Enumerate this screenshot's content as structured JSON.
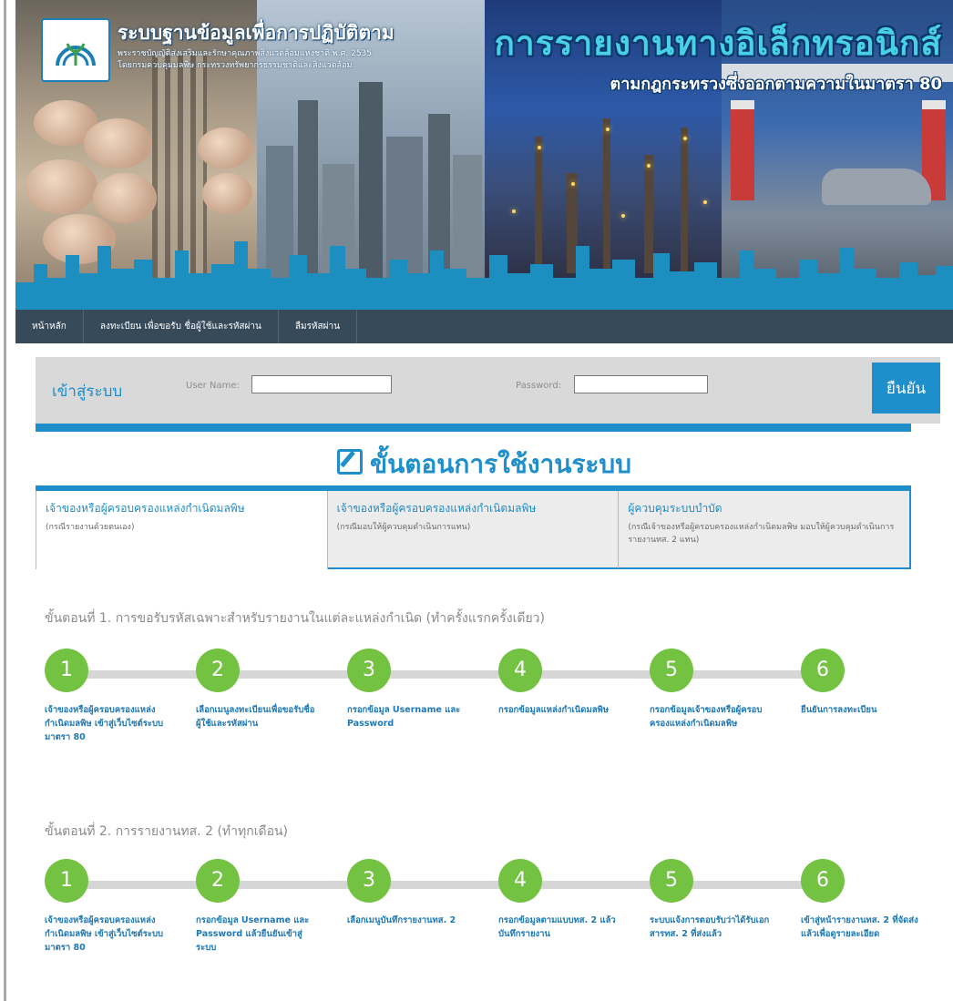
{
  "header": {
    "logo_title": "ระบบฐานข้อมูลเพื่อการปฏิบัติตาม",
    "logo_subtitle_1": "พระราชบัญญัติส่งเสริมและรักษาคุณภาพสิ่งแวดล้อมแห่งชาติ พ.ศ. 2535",
    "logo_subtitle_2": "โดยกรมควบคุมมลพิษ กระทรวงทรัพยากรธรรมชาติและสิ่งแวดล้อม",
    "hero_title": "การรายงานทางอิเล็กทรอนิกส์",
    "hero_subtitle": "ตามกฎกระทรวงซึ่งออกตามความในมาตรา 80"
  },
  "nav": {
    "items": [
      "หน้าหลัก",
      "ลงทะเบียน เพื่อขอรับ ชื่อผู้ใช้และรหัสผ่าน",
      "ลืมรหัสผ่าน"
    ]
  },
  "login": {
    "label": "เข้าสู่ระบบ",
    "username_label": "User Name:",
    "username_value": "",
    "password_label": "Password:",
    "password_value": "",
    "confirm_label": "ยืนยัน"
  },
  "steps_title": "ขั้นตอนการใช้งานระบบ",
  "tabs": [
    {
      "title": "เจ้าของหรือผู้ครอบครองแหล่งกำเนิดมลพิษ",
      "note": "(กรณีรายงานด้วยตนเอง)"
    },
    {
      "title": "เจ้าของหรือผู้ครอบครองแหล่งกำเนิดมลพิษ",
      "note": "(กรณีมอบให้ผู้ควบคุมดำเนินการแทน)"
    },
    {
      "title": "ผู้ควบคุมระบบบำบัด",
      "note": "(กรณีเจ้าของหรือผู้ครอบครองแหล่งกำเนิดมลพิษ มอบให้ผู้ควบคุมดำเนินการรายงานทส. 2 แทน)"
    }
  ],
  "procedure1": {
    "heading": "ขั้นตอนที่ 1. การขอรับรหัสเฉพาะสำหรับรายงานในแต่ละแหล่งกำเนิด (ทำครั้งแรกครั้งเดียว)",
    "steps": [
      {
        "num": "1",
        "text": "เจ้าของหรือผู้ครอบครองแหล่งกำเนิดมลพิษ เข้าสู่เว็บไซต์ระบบมาตรา 80"
      },
      {
        "num": "2",
        "text": "เลือกเมนูลงทะเบียนเพื่อขอรับชื่อผู้ใช้และรหัสผ่าน"
      },
      {
        "num": "3",
        "text": "กรอกข้อมูล Username และ Password"
      },
      {
        "num": "4",
        "text": "กรอกข้อมูลแหล่งกำเนิดมลพิษ"
      },
      {
        "num": "5",
        "text": "กรอกข้อมูลเจ้าของหรือผู้ครอบครองแหล่งกำเนิดมลพิษ"
      },
      {
        "num": "6",
        "text": "ยืนยันการลงทะเบียน"
      }
    ]
  },
  "procedure2": {
    "heading": "ขั้นตอนที่ 2. การรายงานทส. 2 (ทำทุกเดือน)",
    "steps": [
      {
        "num": "1",
        "text": "เจ้าของหรือผู้ครอบครองแหล่งกำเนิดมลพิษ เข้าสู่เว็บไซต์ระบบมาตรา 80"
      },
      {
        "num": "2",
        "text": "กรอกข้อมูล Username และ Password แล้วยืนยันเข้าสู่ระบบ"
      },
      {
        "num": "3",
        "text": "เลือกเมนูบันทึกรายงานทส. 2"
      },
      {
        "num": "4",
        "text": "กรอกข้อมูลตามแบบทส. 2 แล้วบันทึกรายงาน"
      },
      {
        "num": "5",
        "text": "ระบบแจ้งการตอบรับว่าได้รับเอกสารทส. 2 ที่ส่งแล้ว"
      },
      {
        "num": "6",
        "text": "เข้าสู่หน้ารายงานทส. 2 ที่จัดส่งแล้วเพื่อดูรายละเอียด"
      }
    ]
  }
}
